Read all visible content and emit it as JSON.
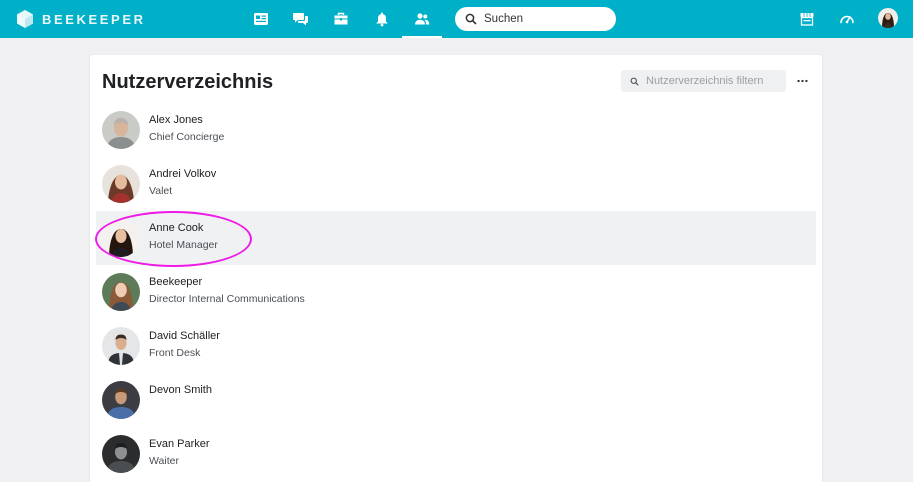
{
  "app": {
    "brand": "BEEKEEPER"
  },
  "header": {
    "nav": [
      {
        "id": "news",
        "icon": "newspaper-icon"
      },
      {
        "id": "chats",
        "icon": "chat-bubbles-icon"
      },
      {
        "id": "tools",
        "icon": "toolbox-icon"
      },
      {
        "id": "notifications",
        "icon": "bell-icon"
      },
      {
        "id": "people",
        "icon": "people-icon",
        "active": true
      }
    ],
    "search": {
      "placeholder": "Suchen"
    },
    "right_icons": [
      "store-icon",
      "dashboard-gauge-icon"
    ]
  },
  "page": {
    "title": "Nutzerverzeichnis",
    "filter_placeholder": "Nutzerverzeichnis filtern"
  },
  "users": [
    {
      "name": "Alex Jones",
      "role": "Chief Concierge"
    },
    {
      "name": "Andrei Volkov",
      "role": "Valet"
    },
    {
      "name": "Anne Cook",
      "role": "Hotel Manager",
      "highlighted": true
    },
    {
      "name": "Beekeeper",
      "role": "Director Internal Communications"
    },
    {
      "name": "David Schäller",
      "role": "Front Desk"
    },
    {
      "name": "Devon Smith",
      "role": ""
    },
    {
      "name": "Evan Parker",
      "role": "Waiter"
    }
  ],
  "colors": {
    "header": "#00b0c8",
    "highlight_row": "#f0f1f3",
    "annotation": "#ee19e6"
  }
}
